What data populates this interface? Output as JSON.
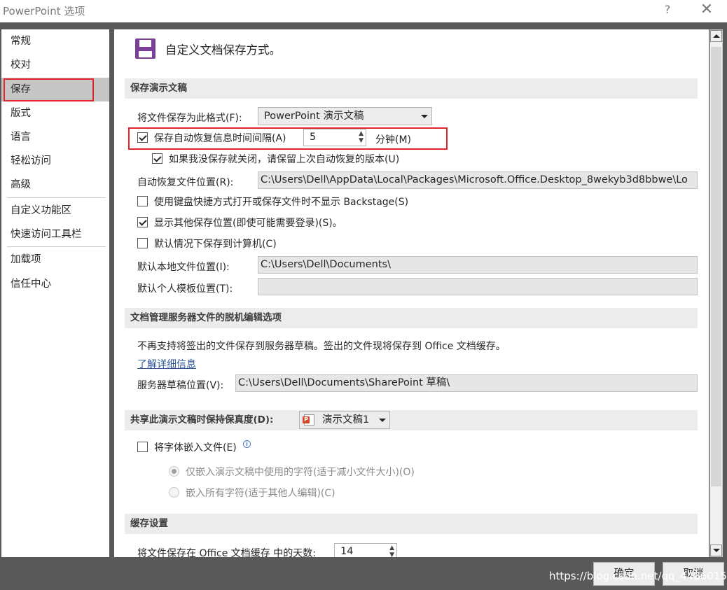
{
  "window": {
    "title": "PowerPoint 选项",
    "help_label": "?",
    "close_label": "✕"
  },
  "sidebar": {
    "items": [
      {
        "label": "常规"
      },
      {
        "label": "校对"
      },
      {
        "label": "保存"
      },
      {
        "label": "版式"
      },
      {
        "label": "语言"
      },
      {
        "label": "轻松访问"
      },
      {
        "label": "高级"
      },
      {
        "label": "自定义功能区"
      },
      {
        "label": "快速访问工具栏"
      },
      {
        "label": "加载项"
      },
      {
        "label": "信任中心"
      }
    ],
    "active_index": 2
  },
  "header": {
    "title": "自定义文档保存方式。",
    "icon": "save-disk-icon",
    "icon_color": "#7b3f98"
  },
  "save_presentations": {
    "section_title": "保存演示文稿",
    "format_label": "将文件保存为此格式(F):",
    "format_value": "PowerPoint 演示文稿",
    "autorecover_label": "保存自动恢复信息时间间隔(A)",
    "autorecover_checked": true,
    "autorecover_minutes": "5",
    "minutes_label": "分钟(M)",
    "keep_last_label": "如果我没保存就关闭，请保留上次自动恢复的版本(U)",
    "keep_last_checked": true,
    "autorecover_location_label": "自动恢复文件位置(R):",
    "autorecover_location_value": "C:\\Users\\Dell\\AppData\\Local\\Packages\\Microsoft.Office.Desktop_8wekyb3d8bbwe\\Lo",
    "no_backstage_label": "使用键盘快捷方式打开或保存文件时不显示 Backstage(S)",
    "no_backstage_checked": false,
    "show_more_locations_label": "显示其他保存位置(即使可能需要登录)(S)。",
    "show_more_locations_checked": true,
    "save_to_computer_label": "默认情况下保存到计算机(C)",
    "save_to_computer_checked": false,
    "default_local_location_label": "默认本地文件位置(I):",
    "default_local_location_value": "C:\\Users\\Dell\\Documents\\",
    "default_template_location_label": "默认个人模板位置(T):",
    "default_template_location_value": ""
  },
  "offline_editing": {
    "section_title": "文档管理服务器文件的脱机编辑选项",
    "notice_text": "不再支持将签出的文件保存到服务器草稿。签出的文件现将保存到 Office 文档缓存。",
    "learn_more_link": "了解详细信息",
    "drafts_location_label": "服务器草稿位置(V):",
    "drafts_location_value": "C:\\Users\\Dell\\Documents\\SharePoint 草稿\\"
  },
  "fidelity": {
    "section_title": "共享此演示文稿时保持保真度(D):",
    "presentation_value": "演示文稿1",
    "embed_fonts_label": "将字体嵌入文件(E)",
    "embed_fonts_checked": false,
    "embed_used_label": "仅嵌入演示文稿中使用的字符(适于减小文件大小)(O)",
    "embed_used_selected": true,
    "embed_all_label": "嵌入所有字符(适于其他人编辑)(C)",
    "embed_all_selected": false
  },
  "cache": {
    "section_title": "缓存设置",
    "days_label": "将文件保存在 Office 文档缓存 中的天数:",
    "days_value": "14"
  },
  "footer": {
    "ok_label": "确定",
    "cancel_label": "取消"
  },
  "watermark": "https://blog.csdn.net/qq_44860153",
  "colors": {
    "highlight_box": "#e0262c",
    "link": "#2b579a",
    "active_nav": "#c6c6c6"
  }
}
